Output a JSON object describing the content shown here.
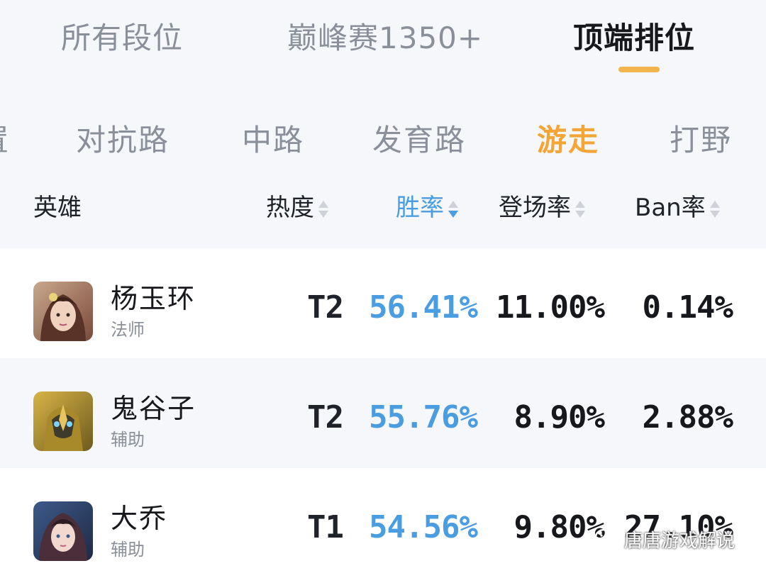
{
  "top_tabs": [
    "所有段位",
    "巅峰赛1350+",
    "顶端排位"
  ],
  "position_tabs": [
    "置",
    "对抗路",
    "中路",
    "发育路",
    "游走",
    "打野"
  ],
  "columns": [
    "英雄",
    "热度",
    "胜率",
    "登场率",
    "Ban率"
  ],
  "heroes": [
    {
      "name": "杨玉环",
      "role": "法师",
      "tier": "T2",
      "win_rate": "56.41%",
      "pick_rate": "11.00%",
      "ban_rate": "0.14%"
    },
    {
      "name": "鬼谷子",
      "role": "辅助",
      "tier": "T2",
      "win_rate": "55.76%",
      "pick_rate": "8.90%",
      "ban_rate": "2.88%"
    },
    {
      "name": "大乔",
      "role": "辅助",
      "tier": "T1",
      "win_rate": "54.56%",
      "pick_rate": "9.80%",
      "ban_rate": "27.10%"
    }
  ],
  "watermark": "唐唐游戏解说",
  "colors": {
    "active_tab": "#16181c",
    "accent_orange": "#f3a536",
    "indicator": "#f2b44d",
    "accent_blue": "#4a9de0"
  }
}
